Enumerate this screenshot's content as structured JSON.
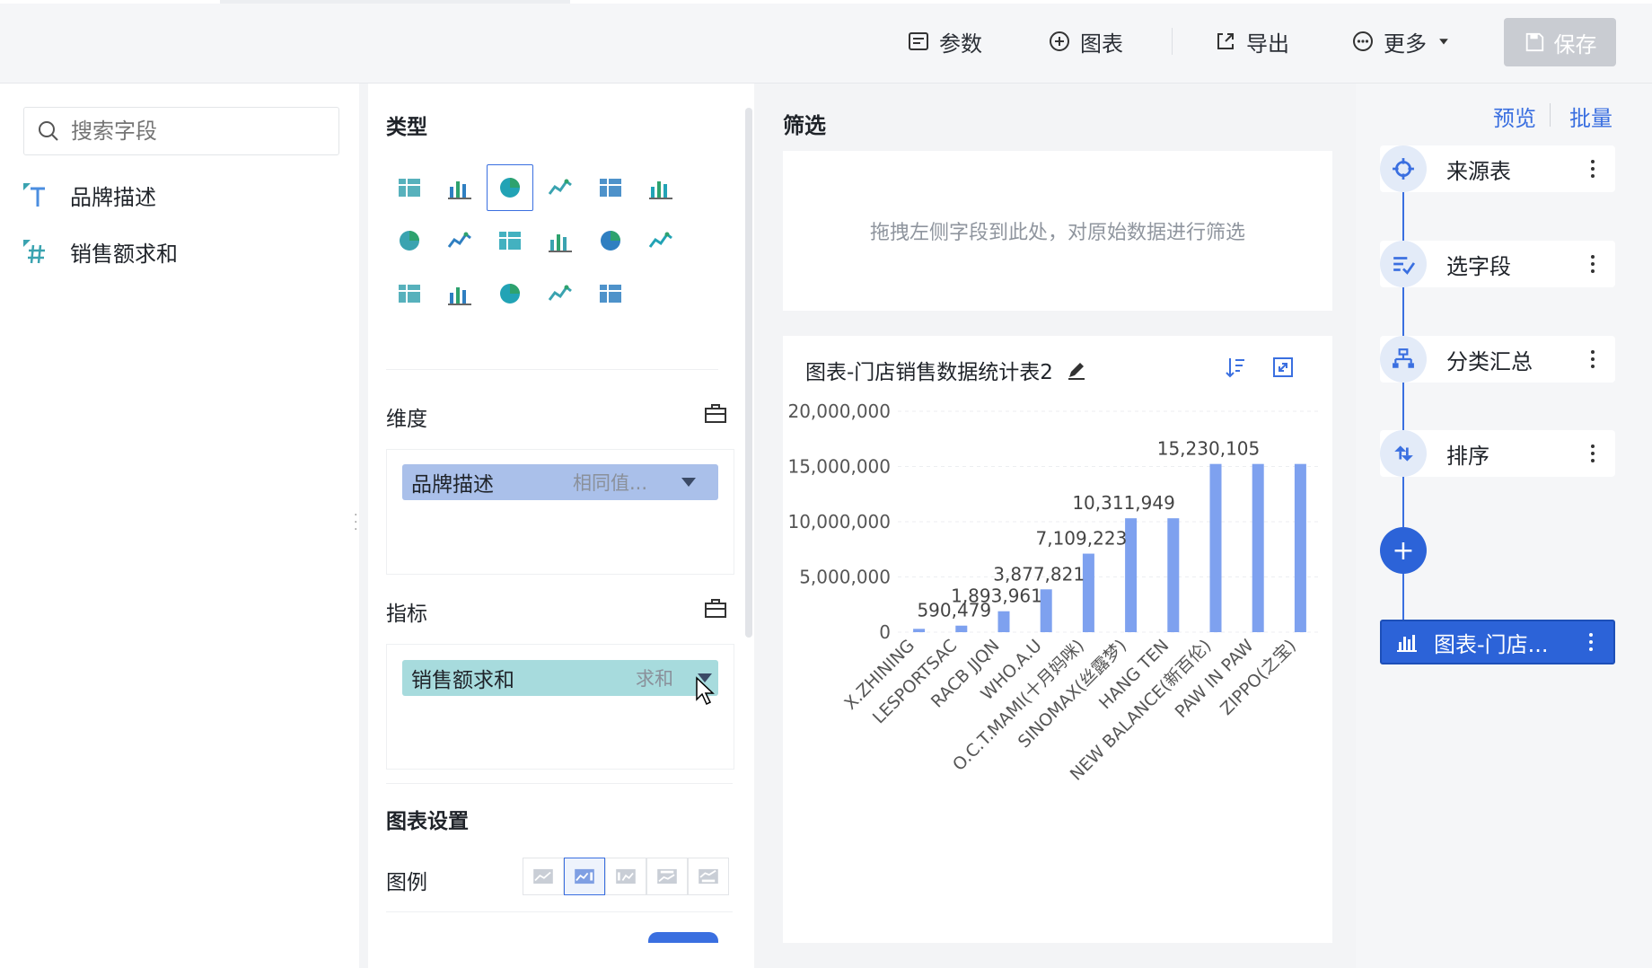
{
  "toolbar": {
    "params_label": "参数",
    "chart_label": "图表",
    "export_label": "导出",
    "more_label": "更多",
    "save_label": "保存"
  },
  "fields_panel": {
    "search_placeholder": "搜索字段",
    "fields": [
      {
        "name": "品牌描述",
        "kind": "text"
      },
      {
        "name": "销售额求和",
        "kind": "number"
      }
    ]
  },
  "config": {
    "type_title": "类型",
    "dimension_label": "维度",
    "dimension_chip": {
      "name": "品牌描述",
      "sub": "相同值..."
    },
    "measure_label": "指标",
    "measure_chip": {
      "name": "销售额求和",
      "sub": "求和"
    },
    "chart_settings_title": "图表设置",
    "legend_label": "图例",
    "type_icons": [
      "table-icon",
      "detail-table-icon",
      "bar-chart-icon",
      "horizontal-bar-icon",
      "line-chart-icon",
      "pie-chart-icon",
      "area-chart-icon",
      "map-icon",
      "gauge-icon",
      "combo-chart-icon",
      "scatter-icon",
      "grid-icon",
      "radar-icon",
      "funnel-icon",
      "number-card-icon",
      "text-icon",
      "heatmap-icon"
    ]
  },
  "filter": {
    "title": "筛选",
    "placeholder": "拖拽左侧字段到此处，对原始数据进行筛选"
  },
  "chart_card": {
    "title": "图表-门店销售数据统计表2"
  },
  "chart_data": {
    "type": "bar",
    "categories": [
      "X.ZHINING",
      "LESPORTSAC",
      "RACB JJQN",
      "WHO.A.U",
      "O.C.T.MAMI(十月妈咪)",
      "SINOMAX(丝露梦)",
      "HANG TEN",
      "NEW BALANCE(新百伦)",
      "PAW IN PAW",
      "ZIPPO(之宝)"
    ],
    "values": [
      300000,
      590479,
      1893961,
      3877821,
      7109223,
      10311949,
      10311949,
      15230105,
      15230105,
      15230105
    ],
    "data_labels": [
      "590,479",
      "1,893,961",
      "3,877,821",
      "7,109,223",
      "10,311,949",
      "15,230,105"
    ],
    "y_ticks": [
      "0",
      "5,000,000",
      "10,000,000",
      "15,000,000",
      "20,000,000"
    ],
    "ylim": [
      0,
      20000000
    ],
    "color": "#7ea1ef"
  },
  "flow": {
    "preview_label": "预览",
    "batch_label": "批量",
    "nodes": [
      {
        "label": "来源表"
      },
      {
        "label": "选字段"
      },
      {
        "label": "分类汇总"
      },
      {
        "label": "排序"
      }
    ],
    "final_node": {
      "label": "图表-门店..."
    }
  },
  "colors": {
    "accent": "#3a6fe0",
    "dimension_chip": "#aac0ea",
    "measure_chip": "#a7dbdd"
  }
}
